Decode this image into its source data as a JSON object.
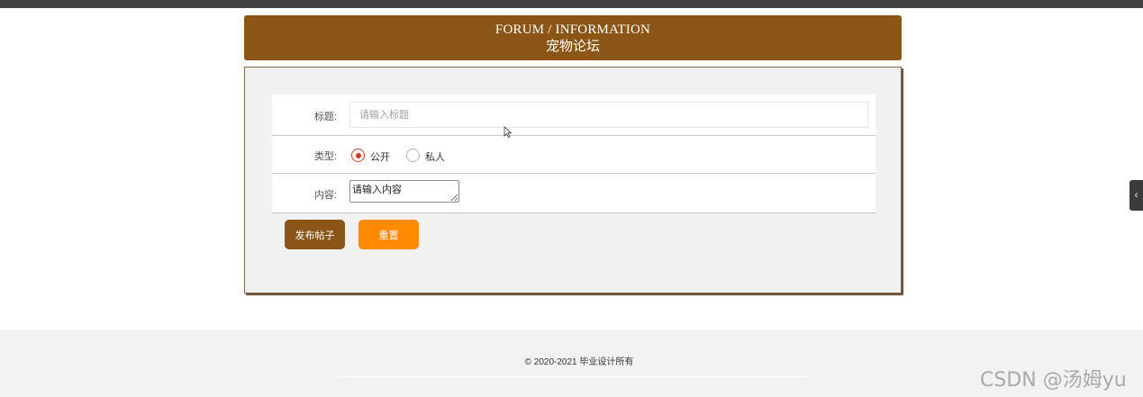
{
  "header": {
    "title_en": "FORUM / INFORMATION",
    "title_cn": "宠物论坛"
  },
  "form": {
    "title_label": "标题:",
    "title_placeholder": "请输入标题",
    "type_label": "类型:",
    "type_options": [
      {
        "label": "公开",
        "checked": true
      },
      {
        "label": "私人",
        "checked": false
      }
    ],
    "content_label": "内容:",
    "content_placeholder": "请输入内容"
  },
  "buttons": {
    "publish": "发布帖子",
    "reset": "重置"
  },
  "side_tab": {
    "icon": "chevron-left-icon",
    "glyph": "‹"
  },
  "footer": {
    "copyright": "© 2020-2021 毕业设计所有"
  },
  "watermark": "CSDN @汤姆yu",
  "colors": {
    "brand_brown": "#8a5515",
    "reset_orange": "#ff8a00",
    "radio_red": "#d33a1d"
  }
}
